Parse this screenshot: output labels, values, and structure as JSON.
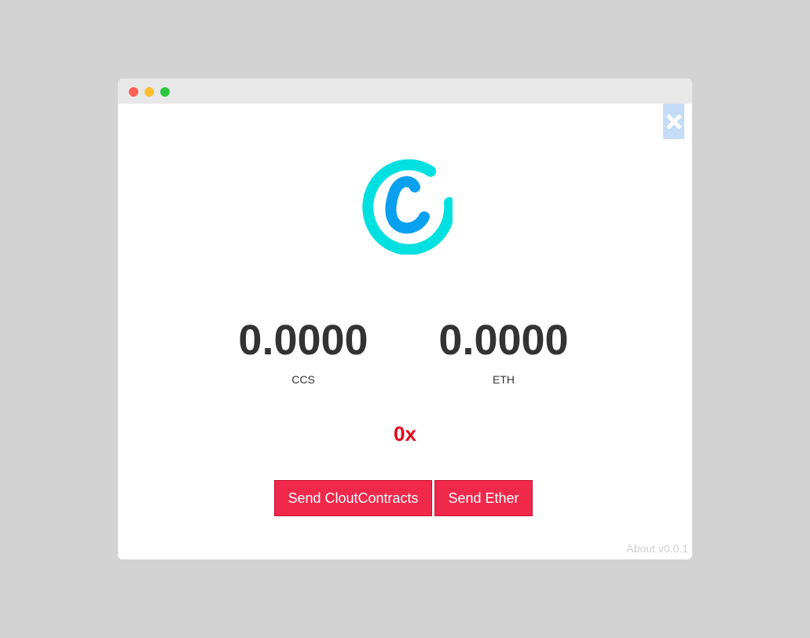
{
  "window": {
    "controls": [
      "close",
      "minimize",
      "zoom"
    ]
  },
  "close_icon": "close-icon",
  "logo": {
    "icon": "cloutcontracts-logo",
    "colors": {
      "ring": "#00e0e0",
      "letter": "#0aa0f0"
    }
  },
  "balances": [
    {
      "amount": "0.0000",
      "unit": "CCS"
    },
    {
      "amount": "0.0000",
      "unit": "ETH"
    }
  ],
  "address": "0x",
  "actions": {
    "send_ccs_label": "Send CloutContracts",
    "send_eth_label": "Send Ether"
  },
  "footer": {
    "about_label": "About v0.0.1"
  },
  "colors": {
    "accent": "#f0284a",
    "address": "#e8001c",
    "background": "#d3d3d3"
  }
}
